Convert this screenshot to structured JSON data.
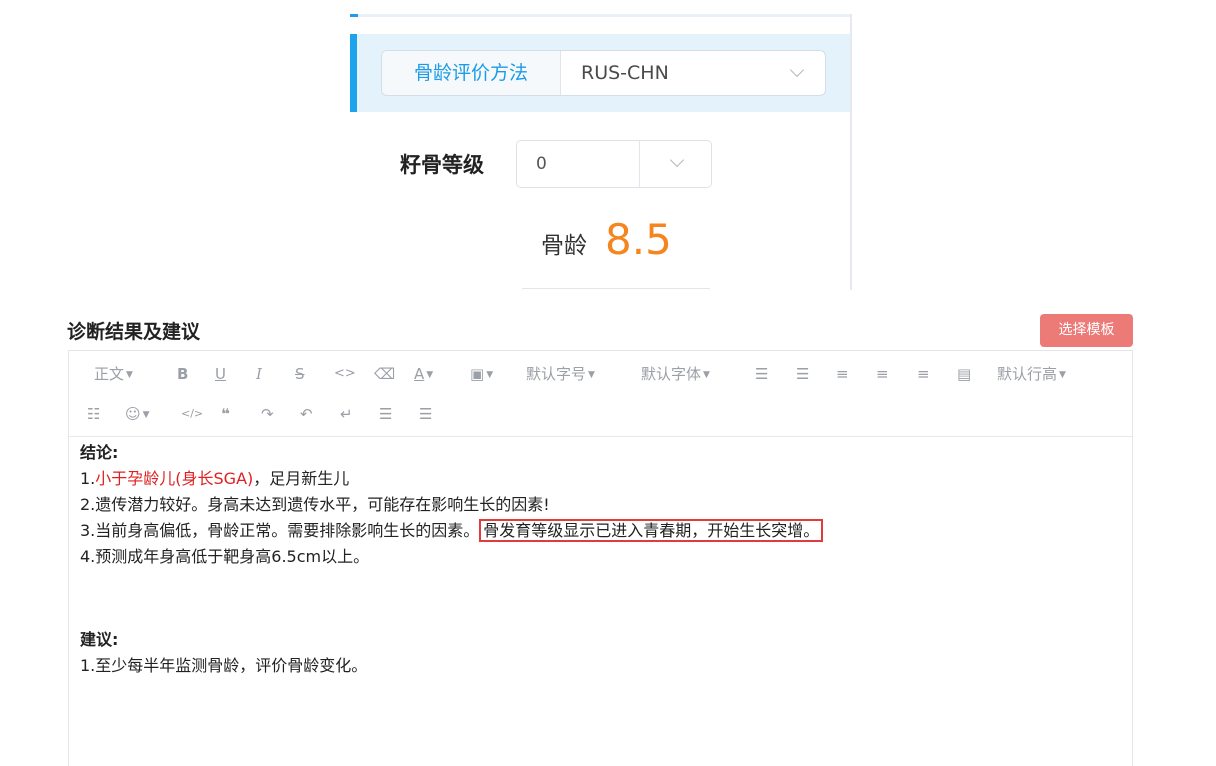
{
  "top_panel": {
    "method_label": "骨龄评价方法",
    "method_value": "RUS-CHN",
    "sesamoid_label": "籽骨等级",
    "sesamoid_value": "0",
    "boneage_label": "骨龄",
    "boneage_value": "8.5"
  },
  "diagnosis": {
    "title": "诊断结果及建议",
    "template_button": "选择模板"
  },
  "toolbar": {
    "paragraph": "正文",
    "bold": "B",
    "underline": "U",
    "italic": "I",
    "strike": "S",
    "code": "<>",
    "font_size": "默认字号",
    "font_family": "默认字体",
    "line_height": "默认行高"
  },
  "content": {
    "conclusion_title": "结论:",
    "line1_prefix": "1.",
    "line1_red": "小于孕龄儿(身长SGA)",
    "line1_rest": "，足月新生儿",
    "line2": "2.遗传潜力较好。身高未达到遗传水平，可能存在影响生长的因素!",
    "line3_plain": "3.当前身高偏低，骨龄正常。需要排除影响生长的因素。",
    "line3_boxed": "骨发育等级显示已进入青春期，开始生长突增。",
    "line4": "4.预测成年身高低于靶身高6.5cm以上。",
    "advice_title": "建议:",
    "advice1": "1.至少每半年监测骨龄，评价骨龄变化。"
  },
  "colors": {
    "accent_blue": "#1ea2ec",
    "boneage_orange": "#f5861f",
    "template_button": "#ec7b78",
    "highlight_red": "#e02020"
  }
}
